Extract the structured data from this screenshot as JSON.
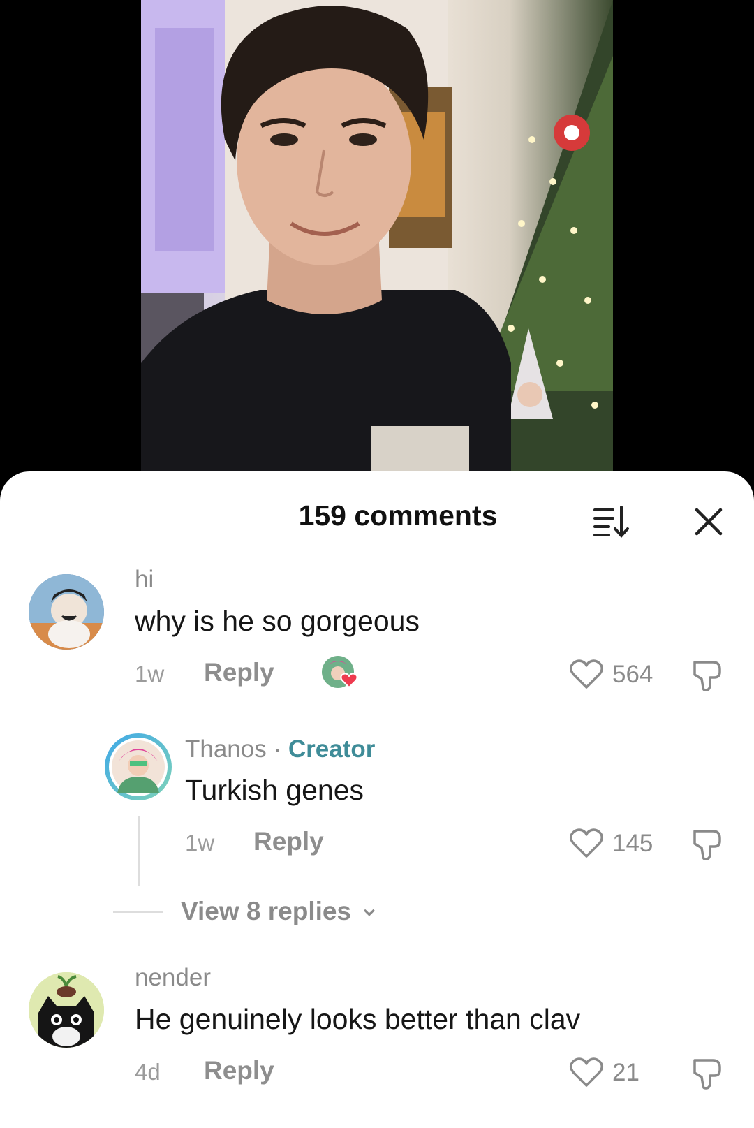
{
  "sheet": {
    "title": "159 comments",
    "sort_icon": "sort-icon",
    "close_icon": "close-icon"
  },
  "comments": [
    {
      "username": "hi",
      "text": "why is he so gorgeous",
      "time": "1w",
      "reply_label": "Reply",
      "likes": "564",
      "creator_liked": true
    },
    {
      "username": "Thanos",
      "separator": "·",
      "badge": "Creator",
      "text": "Turkish genes",
      "time": "1w",
      "reply_label": "Reply",
      "likes": "145"
    },
    {
      "username": "nender",
      "text": "He genuinely looks better than clav",
      "time": "4d",
      "reply_label": "Reply",
      "likes": "21"
    }
  ],
  "view_replies": {
    "label": "View 8 replies",
    "chevron": "⌄"
  },
  "colors": {
    "creator": "#3f8c98",
    "heart": "#ee3b4f",
    "muted": "#8a8a8a"
  }
}
